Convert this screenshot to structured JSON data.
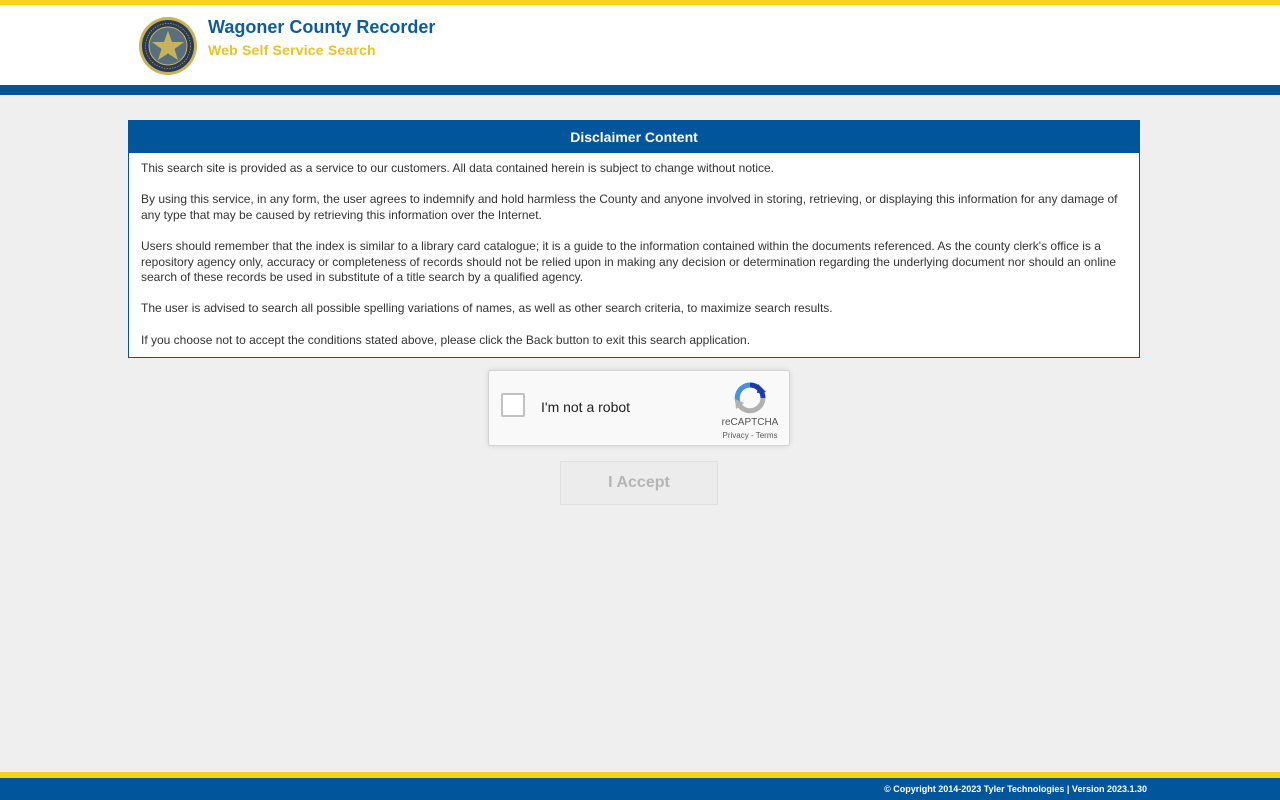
{
  "header": {
    "title": "Wagoner County Recorder",
    "subtitle": "Web Self Service Search",
    "seal_icon": "county-seal-icon"
  },
  "disclaimer": {
    "heading": "Disclaimer Content",
    "paragraphs": [
      "This search site is provided as a service to our customers. All data contained herein is subject to change without notice.",
      "By using this service, in any form, the user agrees to indemnify and hold harmless the County and anyone involved in storing, retrieving, or displaying this information for any damage of any type that may be caused by retrieving this information over the Internet.",
      "Users should remember that the index is similar to a library card catalogue; it is a guide to the information contained within the documents referenced.  As the county clerk's office is a repository agency only, accuracy or completeness of records should not be relied upon in making any decision or determination regarding the underlying document nor should an online search of these records be used in substitute of a title search by a qualified agency.",
      "The user is advised to search all possible spelling variations of names, as well as other search criteria, to maximize search results.",
      "If you choose not to accept the conditions stated above, please click the Back button to exit this search application."
    ]
  },
  "captcha": {
    "label": "I'm not a robot",
    "brand": "reCAPTCHA",
    "privacy": "Privacy",
    "separator": " - ",
    "terms": "Terms",
    "checked": false
  },
  "accept_button": {
    "label": "I Accept",
    "disabled": true
  },
  "footer": {
    "copyright": "© Copyright 2014-2023 Tyler Technologies | Version 2023.1.30"
  },
  "colors": {
    "primary_blue": "#00559b",
    "accent_yellow": "#f2d41e",
    "background": "#efefef"
  }
}
